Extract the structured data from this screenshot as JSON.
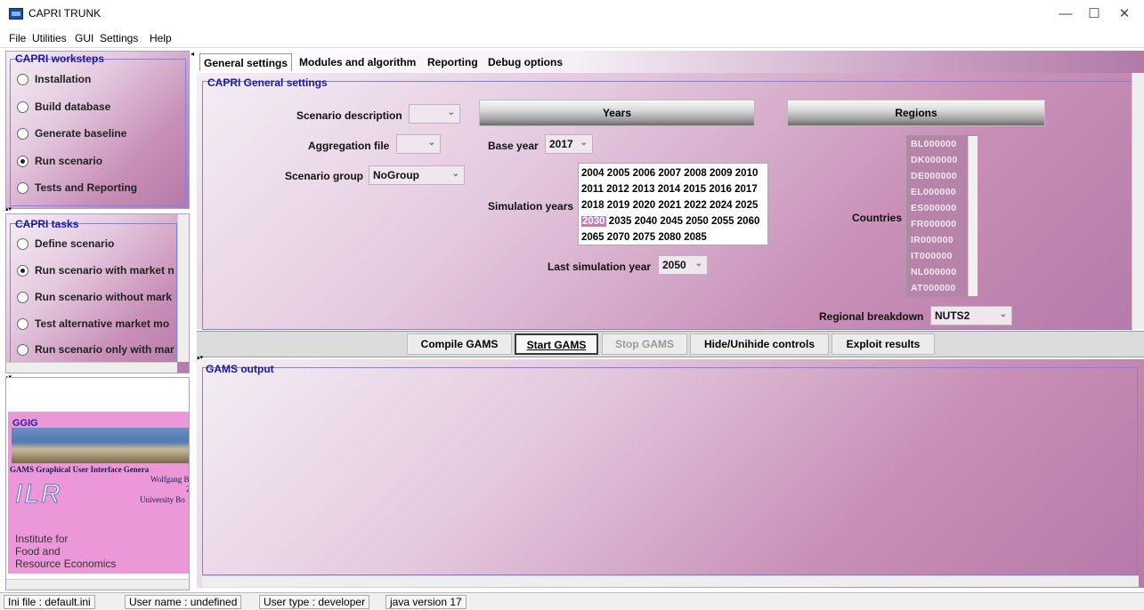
{
  "window": {
    "title": "CAPRI TRUNK",
    "minimize": "—",
    "maximize": "☐",
    "close": "✕"
  },
  "menu": [
    "File",
    "Utilities",
    "GUI",
    "Settings",
    "Help"
  ],
  "worksteps": {
    "title": "CAPRI worksteps",
    "items": [
      {
        "label": "Installation",
        "selected": false
      },
      {
        "label": "Build database",
        "selected": false
      },
      {
        "label": "Generate baseline",
        "selected": false
      },
      {
        "label": "Run scenario",
        "selected": true
      },
      {
        "label": "Tests and Reporting",
        "selected": false
      }
    ]
  },
  "tasks": {
    "title": "CAPRI tasks",
    "items": [
      {
        "label": "Define scenario",
        "selected": false
      },
      {
        "label": "Run scenario with market n",
        "selected": true
      },
      {
        "label": "Run scenario without mark",
        "selected": false
      },
      {
        "label": "Test alternative market mo",
        "selected": false
      },
      {
        "label": "Run scenario only with mar",
        "selected": false
      }
    ]
  },
  "logo_panel": {
    "ggig": "GGIG",
    "subtitle": "GAMS Graphical User Interface Genera",
    "author": "Wolfgang B",
    "year": "20",
    "university": "University Bo",
    "ilr": "ILR",
    "institute_line1": "Institute for",
    "institute_line2": "Food and",
    "institute_line3": "Resource Economics"
  },
  "tabs": [
    "General settings",
    "Modules and algorithm",
    "Reporting",
    "Debug options"
  ],
  "general": {
    "group_title": "CAPRI General settings",
    "scenario_description_label": "Scenario description",
    "scenario_description_value": "",
    "aggregation_file_label": "Aggregation file",
    "aggregation_file_value": "",
    "scenario_group_label": "Scenario group",
    "scenario_group_value": "NoGroup",
    "years_header": "Years",
    "regions_header": "Regions",
    "base_year_label": "Base year",
    "base_year_value": "2017",
    "simulation_years_label": "Simulation years",
    "simulation_years_rows": [
      [
        "2004",
        "2005",
        "2006",
        "2007",
        "2008",
        "2009",
        "2010"
      ],
      [
        "2011",
        "2012",
        "2013",
        "2014",
        "2015",
        "2016",
        "2017"
      ],
      [
        "2018",
        "2019",
        "2020",
        "2021",
        "2022",
        "2024",
        "2025"
      ],
      [
        "2030",
        "2035",
        "2040",
        "2045",
        "2050",
        "2055",
        "2060"
      ],
      [
        "2065",
        "2070",
        "2075",
        "2080",
        "2085"
      ]
    ],
    "selected_year": "2030",
    "last_simulation_year_label": "Last simulation year",
    "last_simulation_year_value": "2050",
    "countries_label": "Countries",
    "countries": [
      "BL000000",
      "DK000000",
      "DE000000",
      "EL000000",
      "ES000000",
      "FR000000",
      "IR000000",
      "IT000000",
      "NL000000",
      "AT000000"
    ],
    "regional_breakdown_label": "Regional breakdown",
    "regional_breakdown_value": "NUTS2"
  },
  "buttons": {
    "compile": "Compile GAMS",
    "start": "Start GAMS",
    "stop": "Stop GAMS",
    "hide": "Hide/Unihide controls",
    "exploit": "Exploit results"
  },
  "gams_output": {
    "title": "GAMS output"
  },
  "status": {
    "ini": "Ini file : default.ini",
    "user": "User name : undefined",
    "type": "User type : developer",
    "java": "java version 17"
  }
}
